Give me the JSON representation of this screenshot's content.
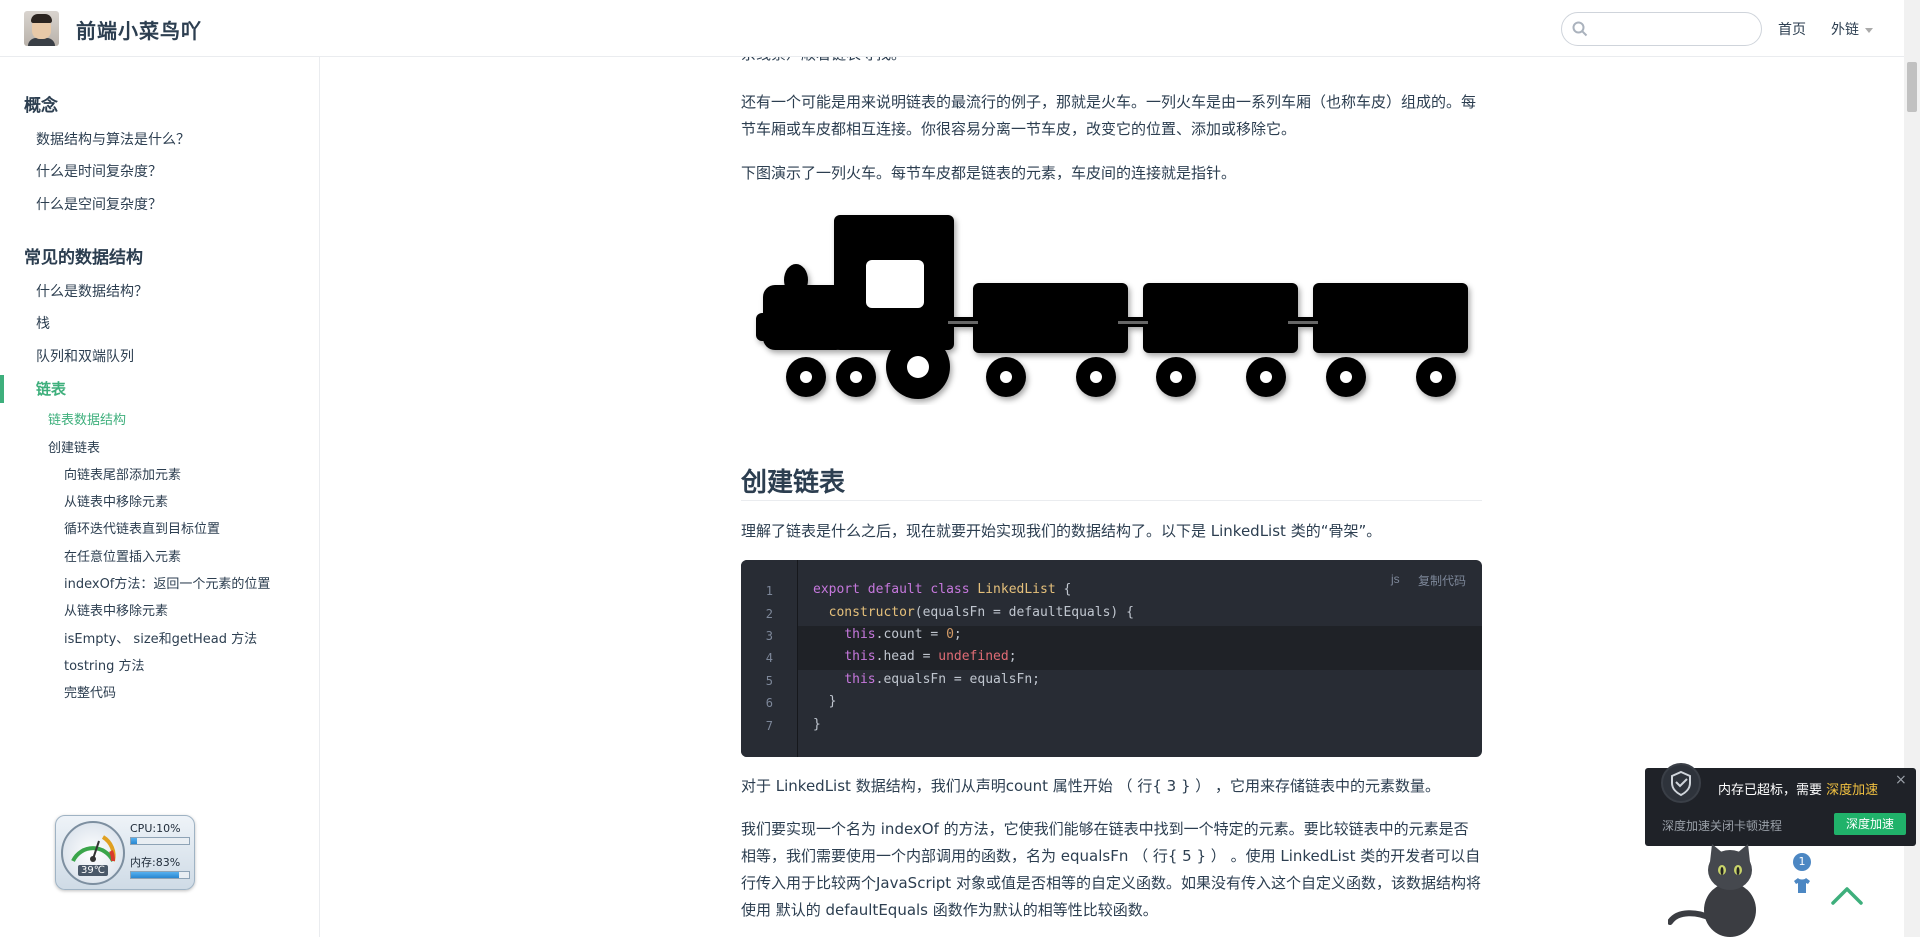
{
  "navbar": {
    "site_title": "前端小菜鸟吖",
    "search_placeholder": "",
    "home_label": "首页",
    "links_label": "外链"
  },
  "sidebar": {
    "groups": [
      {
        "label": "概念",
        "items": [
          "数据结构与算法是什么？",
          "什么是时间复杂度？",
          "什么是空间复杂度？"
        ]
      },
      {
        "label": "常见的数据结构",
        "items": [
          "什么是数据结构？",
          "栈",
          "队列和双端队列",
          "链表"
        ]
      }
    ],
    "active_item": "链表",
    "subitems": [
      "链表数据结构",
      "创建链表"
    ],
    "subitems2": [
      "向链表尾部添加元素",
      "从链表中移除元素",
      "循环迭代链表直到目标位置",
      "在任意位置插入元素",
      "indexOf方法：返回一个元素的位置",
      "从链表中移除元素",
      "isEmpty、 size和getHead 方法",
      "tostring 方法",
      "完整代码"
    ]
  },
  "content": {
    "top_partial": "余线索）顺着链表寻找。",
    "p1": "还有一个可能是用来说明链表的最流行的例子，那就是火车。一列火车是由一系列车厢（也称车皮）组成的。每节车厢或车皮都相互连接。你很容易分离一节车皮，改变它的位置、添加或移除它。",
    "p2": "下图演示了一列火车。每节车皮都是链表的元素，车皮间的连接就是指针。",
    "heading": "创建链表",
    "p3": "理解了链表是什么之后，现在就要开始实现我们的数据结构了。以下是 LinkedList 类的“骨架”。",
    "p4": "对于 LinkedList 数据结构，我们从声明count 属性开始 （ 行{ 3 } ） ，它用来存储链表中的元素数量。",
    "p5": "我们要实现一个名为 indexOf 的方法，它使我们能够在链表中找到一个特定的元素。要比较链表中的元素是否相等，我们需要使用一个内部调用的函数，名为 equalsFn （ 行{ 5 } ） 。使用 LinkedList 类的开发者可以自行传入用于比较两个JavaScript 对象或值是否相等的自定义函数。如果没有传入这个自定义函数，该数据结构将使用 默认的 defaultEquals 函数作为默认的相等性比较函数。"
  },
  "code": {
    "lang": "js",
    "copy_label": "复制代码",
    "line_numbers": [
      "1",
      "2",
      "3",
      "4",
      "5",
      "6",
      "7"
    ],
    "lines": [
      "export default class LinkedList {",
      "  constructor(equalsFn = defaultEquals) {",
      "    this.count = 0;",
      "    this.head = undefined;",
      "    this.equalsFn = equalsFn;",
      "  }",
      "}"
    ]
  },
  "gauge": {
    "cpu_label": "CPU:10%",
    "mem_label": "内存:83%",
    "temp_label": "39℃",
    "cpu_level": 0.1,
    "mem_level": 0.83
  },
  "notify": {
    "title_prefix": "内存已超标，需要",
    "title_highlight": "深度加速",
    "subtitle": "深度加速关闭卡顿进程",
    "button": "深度加速",
    "close": "×"
  },
  "widgets": {
    "bubble_count": "1"
  },
  "colors": {
    "accent": "#3eaf7c",
    "code_bg": "#282c34",
    "notify_button": "#20b26a"
  }
}
